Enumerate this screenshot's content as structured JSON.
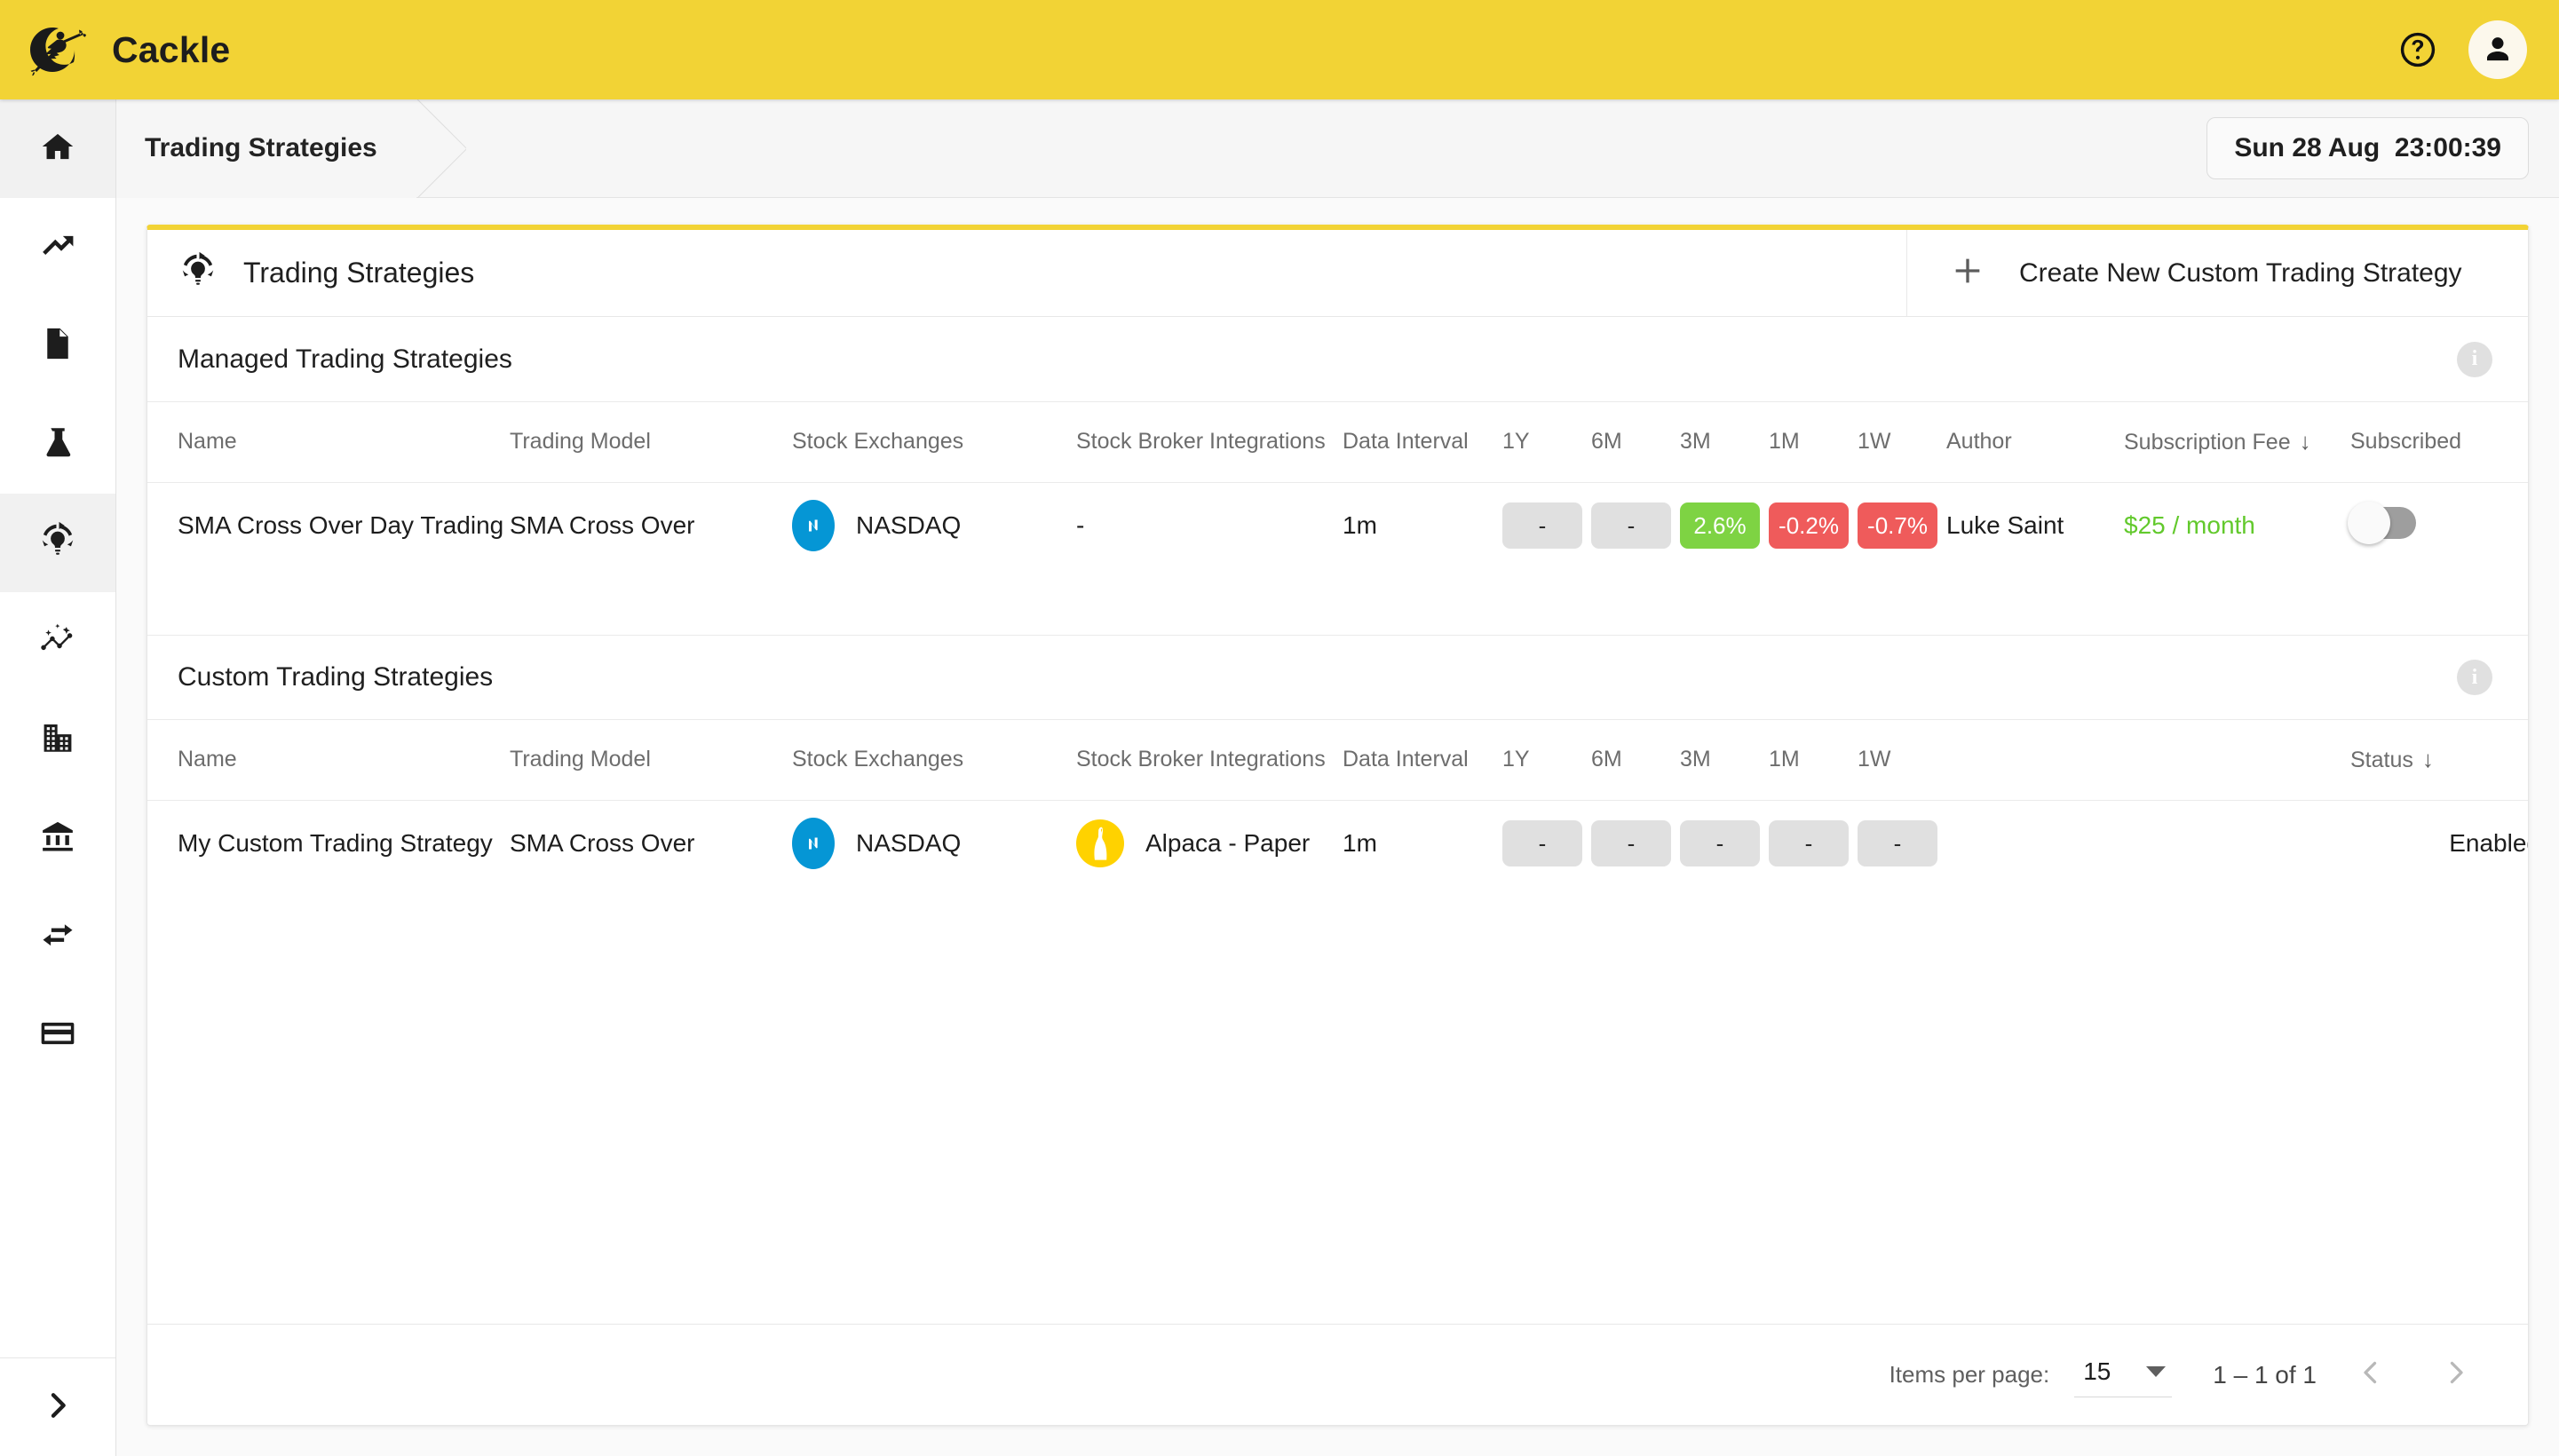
{
  "app": {
    "brand": "Cackle",
    "logo_icon": "witch-on-broom-moon-logo",
    "accent_color": "#F2D335"
  },
  "topbar": {
    "help_icon": "help-circle-icon",
    "avatar_icon": "person-icon"
  },
  "sidebar": {
    "items": [
      {
        "icon": "home-icon",
        "name": "sidebar-item-home",
        "active": true
      },
      {
        "icon": "trending-up-icon",
        "name": "sidebar-item-trending",
        "active": false
      },
      {
        "icon": "document-icon",
        "name": "sidebar-item-documents",
        "active": false
      },
      {
        "icon": "flask-icon",
        "name": "sidebar-item-lab",
        "active": false
      },
      {
        "icon": "strategy-bulb-refresh-icon",
        "name": "sidebar-item-trading-strategies",
        "active": true
      },
      {
        "icon": "auto-graph-icon",
        "name": "sidebar-item-auto-graph",
        "active": false
      },
      {
        "icon": "business-icon",
        "name": "sidebar-item-business",
        "active": false
      },
      {
        "icon": "bank-icon",
        "name": "sidebar-item-bank",
        "active": false
      },
      {
        "icon": "swap-horizontal-icon",
        "name": "sidebar-item-transfers",
        "active": false
      },
      {
        "icon": "credit-card-icon",
        "name": "sidebar-item-billing",
        "active": false
      }
    ],
    "expand_icon": "chevron-right-icon"
  },
  "breadcrumb": {
    "title": "Trading Strategies",
    "datetime": "Sun 28 Aug  23:00:39"
  },
  "card": {
    "icon": "strategy-bulb-refresh-icon",
    "title": "Trading Strategies",
    "create_button": {
      "icon": "plus-icon",
      "label": "Create New Custom Trading Strategy"
    }
  },
  "managed": {
    "section_title": "Managed Trading Strategies",
    "info_icon": "info-icon",
    "columns": [
      "Name",
      "Trading Model",
      "Stock Exchanges",
      "Stock Broker Integrations",
      "Data Interval",
      "1Y",
      "6M",
      "3M",
      "1M",
      "1W",
      "Author",
      "Subscription Fee",
      "Subscribed"
    ],
    "sorted_column": "Subscription Fee",
    "sort_direction_icon": "arrow-down-icon",
    "rows": [
      {
        "name": "SMA Cross Over Day Trading",
        "trading_model": "SMA Cross Over",
        "exchange": "NASDAQ",
        "exchange_logo": "nasdaq-logo",
        "broker": "-",
        "data_interval": "1m",
        "perf": [
          {
            "period": "1Y",
            "value": "-",
            "state": "none"
          },
          {
            "period": "6M",
            "value": "-",
            "state": "none"
          },
          {
            "period": "3M",
            "value": "2.6%",
            "state": "positive"
          },
          {
            "period": "1M",
            "value": "-0.2%",
            "state": "negative"
          },
          {
            "period": "1W",
            "value": "-0.7%",
            "state": "negative"
          }
        ],
        "author": "Luke Saint",
        "subscription_fee": "$25 / month",
        "subscribed": false,
        "menu_icon": "more-vertical-icon"
      }
    ]
  },
  "custom": {
    "section_title": "Custom Trading Strategies",
    "info_icon": "info-icon",
    "columns": [
      "Name",
      "Trading Model",
      "Stock Exchanges",
      "Stock Broker Integrations",
      "Data Interval",
      "1Y",
      "6M",
      "3M",
      "1M",
      "1W",
      "Status"
    ],
    "sorted_column": "Status",
    "sort_direction_icon": "arrow-down-icon",
    "rows": [
      {
        "name": "My Custom Trading Strategy",
        "trading_model": "SMA Cross Over",
        "exchange": "NASDAQ",
        "exchange_logo": "nasdaq-logo",
        "broker": "Alpaca - Paper",
        "broker_logo": "alpaca-logo",
        "data_interval": "1m",
        "perf": [
          {
            "period": "1Y",
            "value": "-",
            "state": "none"
          },
          {
            "period": "6M",
            "value": "-",
            "state": "none"
          },
          {
            "period": "3M",
            "value": "-",
            "state": "none"
          },
          {
            "period": "1M",
            "value": "-",
            "state": "none"
          },
          {
            "period": "1W",
            "value": "-",
            "state": "none"
          }
        ],
        "status": "Enabled",
        "menu_icon": "more-vertical-icon"
      }
    ]
  },
  "paginator": {
    "items_per_page_label": "Items per page:",
    "items_per_page_value": "15",
    "range_label": "1 – 1 of 1",
    "prev_icon": "chevron-left-icon",
    "next_icon": "chevron-right-icon"
  },
  "colors": {
    "positive": "#7ED343",
    "negative": "#EF5B5B",
    "neutral_chip": "#E0E0E0",
    "fee_text": "#62C92C",
    "brand_yellow": "#F2D335",
    "nasdaq_blue": "#0596D5",
    "alpaca_yellow": "#FFD200"
  }
}
